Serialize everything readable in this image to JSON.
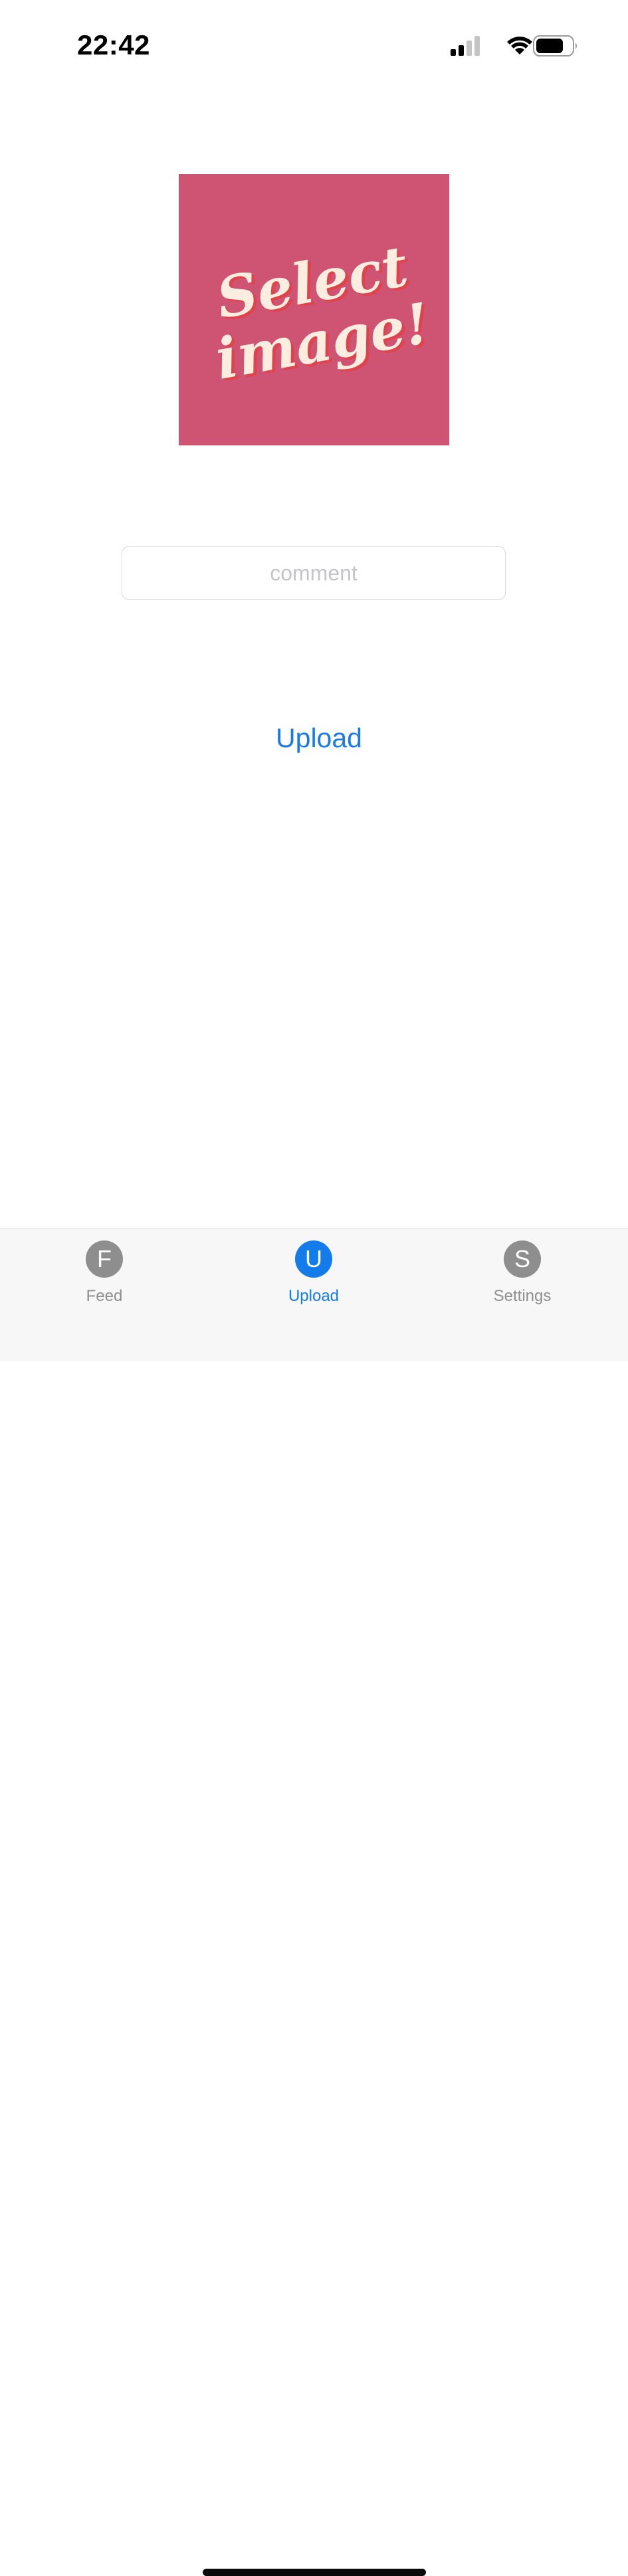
{
  "status_bar": {
    "time": "22:42",
    "icons": [
      "cellular-signal-icon",
      "wifi-icon",
      "battery-icon"
    ]
  },
  "image_picker": {
    "text_line1": "Select",
    "text_line2": "image!",
    "background_color": "#cf5372",
    "text_color": "#fbeee0"
  },
  "comment": {
    "placeholder": "comment",
    "value": ""
  },
  "upload_button": {
    "label": "Upload",
    "color": "#1a7ae6"
  },
  "tab_bar": {
    "tabs": [
      {
        "icon_letter": "F",
        "label": "Feed",
        "active": false
      },
      {
        "icon_letter": "U",
        "label": "Upload",
        "active": true
      },
      {
        "icon_letter": "S",
        "label": "Settings",
        "active": false
      }
    ],
    "active_color": "#147bea",
    "inactive_color": "#8e8e8e"
  }
}
